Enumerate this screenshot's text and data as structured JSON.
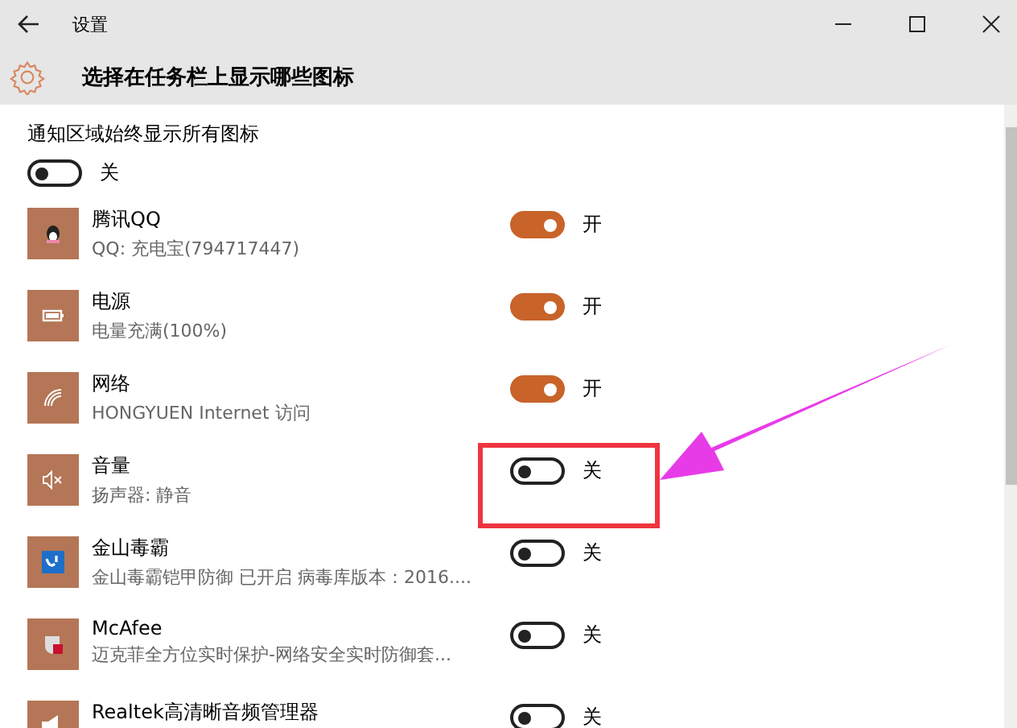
{
  "window": {
    "title": "设置"
  },
  "header": {
    "title": "选择在任务栏上显示哪些图标"
  },
  "always_show": {
    "label": "通知区域始终显示所有图标",
    "on": false,
    "state_label": "关"
  },
  "apps": [
    {
      "kind": "penguin",
      "name": "腾讯QQ",
      "detail": "QQ: 充电宝(794717447)",
      "on": true,
      "state_label": "开",
      "highlighted": false
    },
    {
      "kind": "battery",
      "name": "电源",
      "detail": "电量充满(100%)",
      "on": true,
      "state_label": "开",
      "highlighted": false
    },
    {
      "kind": "wifi",
      "name": "网络",
      "detail": "HONGYUEN Internet 访问",
      "on": true,
      "state_label": "开",
      "highlighted": false
    },
    {
      "kind": "mute",
      "name": "音量",
      "detail": "扬声器: 静音",
      "on": false,
      "state_label": "关",
      "highlighted": true
    },
    {
      "kind": "shield",
      "name": "金山毒霸",
      "detail": "金山毒霸铠甲防御 已开启 病毒库版本：2016....",
      "on": false,
      "state_label": "关",
      "highlighted": false
    },
    {
      "kind": "badge",
      "name": "McAfee",
      "detail": "迈克菲全方位实时保护-网络安全实时防御套...",
      "on": false,
      "state_label": "关",
      "highlighted": false
    },
    {
      "kind": "speaker",
      "name": "Realtek高清晰音频管理器",
      "on": false,
      "state_label": "关",
      "highlighted": false
    }
  ]
}
